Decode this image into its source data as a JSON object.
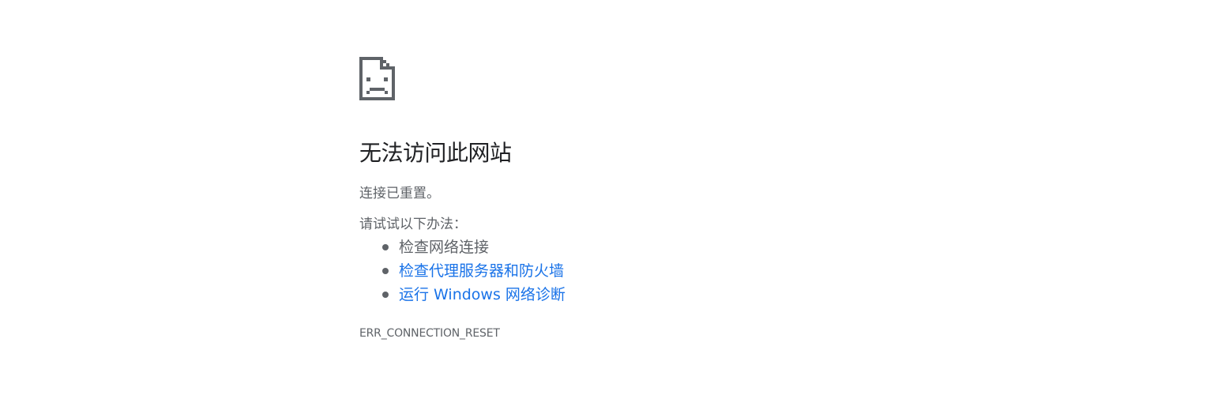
{
  "error": {
    "icon": "sad-page-icon",
    "heading": "无法访问此网站",
    "reason": "连接已重置。",
    "suggest_intro": "请试试以下办法：",
    "suggestions": [
      {
        "label": "检查网络连接",
        "link": false
      },
      {
        "label": "检查代理服务器和防火墙",
        "link": true
      },
      {
        "label": "运行 Windows 网络诊断",
        "link": true
      }
    ],
    "code": "ERR_CONNECTION_RESET"
  },
  "colors": {
    "heading": "#202124",
    "body_text": "#5f6368",
    "link": "#1a73e8",
    "background": "#ffffff"
  }
}
